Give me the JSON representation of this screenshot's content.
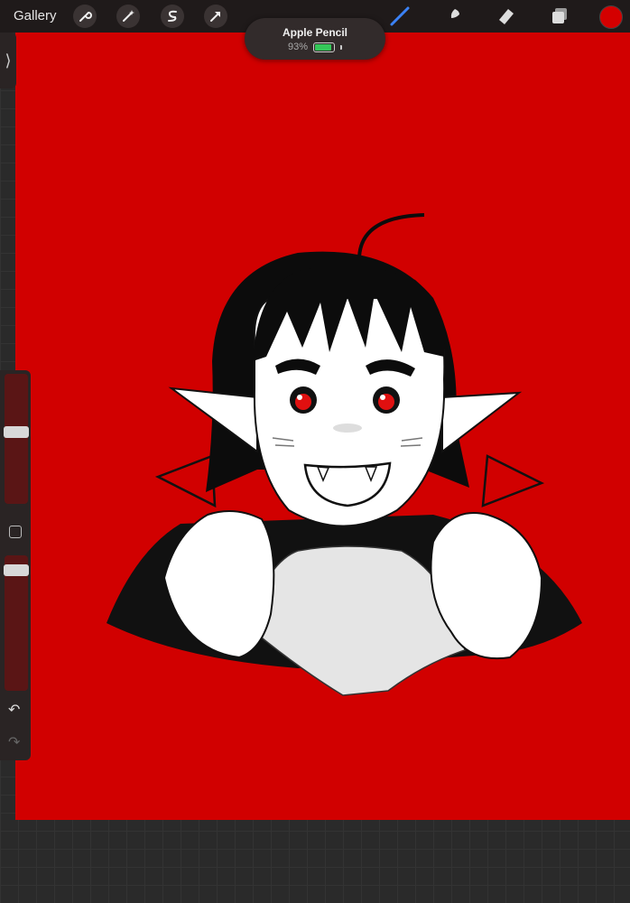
{
  "topbar": {
    "gallery_label": "Gallery",
    "left_tools": [
      "wrench-icon",
      "magic-wand-icon",
      "selection-s-icon",
      "transform-arrow-icon"
    ],
    "right_tools": [
      "brush-icon",
      "smudge-icon",
      "eraser-icon",
      "layers-icon"
    ],
    "active_color": "#d40000"
  },
  "pencil_status": {
    "title": "Apple Pencil",
    "battery_percent": "93%",
    "battery_level": 0.93
  },
  "canvas": {
    "background": "#d10000"
  },
  "sidebar": {
    "brush_size_level": 0.56,
    "opacity_level": 0.93,
    "modify_button": "square-icon",
    "undo": "undo-icon",
    "redo": "redo-icon"
  }
}
